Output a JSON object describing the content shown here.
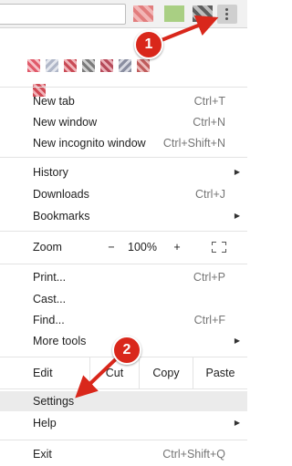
{
  "toolbar": {
    "menu_button_icon": "three-dots-vertical-icon",
    "extension_icons": [
      "extension-icon-1",
      "extension-icon-2",
      "extension-icon-3"
    ]
  },
  "menu": {
    "group1": [
      {
        "label": "New tab",
        "shortcut": "Ctrl+T"
      },
      {
        "label": "New window",
        "shortcut": "Ctrl+N"
      },
      {
        "label": "New incognito window",
        "shortcut": "Ctrl+Shift+N"
      }
    ],
    "group2": [
      {
        "label": "History",
        "submenu": true
      },
      {
        "label": "Downloads",
        "shortcut": "Ctrl+J"
      },
      {
        "label": "Bookmarks",
        "submenu": true
      }
    ],
    "zoom": {
      "label": "Zoom",
      "minus": "−",
      "value": "100%",
      "plus": "+"
    },
    "group3": [
      {
        "label": "Print...",
        "shortcut": "Ctrl+P"
      },
      {
        "label": "Cast..."
      },
      {
        "label": "Find...",
        "shortcut": "Ctrl+F"
      },
      {
        "label": "More tools",
        "submenu": true
      }
    ],
    "edit": {
      "label": "Edit",
      "cut": "Cut",
      "copy": "Copy",
      "paste": "Paste"
    },
    "group4": [
      {
        "label": "Settings",
        "highlighted": true
      },
      {
        "label": "Help",
        "submenu": true
      }
    ],
    "exit": {
      "label": "Exit",
      "shortcut": "Ctrl+Shift+Q"
    }
  },
  "annotations": {
    "step1": "1",
    "step2": "2",
    "color": "#d9271b"
  },
  "colors": {
    "highlight": "#ebebeb",
    "separator": "#e3e3e3",
    "shortcut_text": "#757575"
  }
}
